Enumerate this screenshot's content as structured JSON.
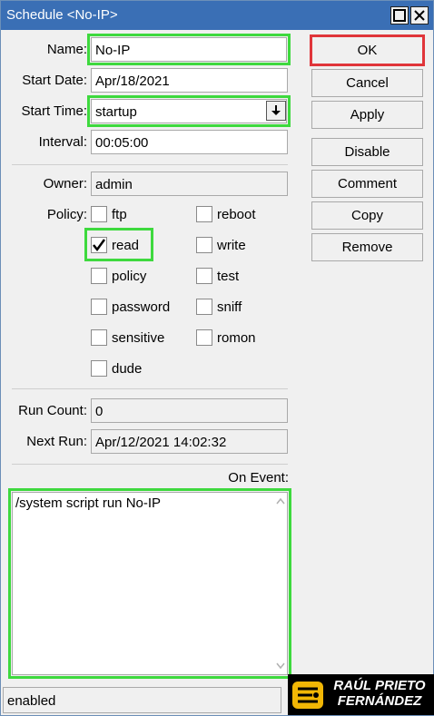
{
  "window": {
    "title": "Schedule <No-IP>"
  },
  "form": {
    "name_label": "Name:",
    "name_value": "No-IP",
    "start_date_label": "Start Date:",
    "start_date_value": "Apr/18/2021",
    "start_time_label": "Start Time:",
    "start_time_value": "startup",
    "interval_label": "Interval:",
    "interval_value": "00:05:00",
    "owner_label": "Owner:",
    "owner_value": "admin",
    "policy_label": "Policy:",
    "run_count_label": "Run Count:",
    "run_count_value": "0",
    "next_run_label": "Next Run:",
    "next_run_value": "Apr/12/2021 14:02:32",
    "on_event_label": "On Event:",
    "on_event_value": "/system script run No-IP"
  },
  "policies": [
    {
      "label": "ftp",
      "checked": false
    },
    {
      "label": "reboot",
      "checked": false
    },
    {
      "label": "read",
      "checked": true
    },
    {
      "label": "write",
      "checked": false
    },
    {
      "label": "policy",
      "checked": false
    },
    {
      "label": "test",
      "checked": false
    },
    {
      "label": "password",
      "checked": false
    },
    {
      "label": "sniff",
      "checked": false
    },
    {
      "label": "sensitive",
      "checked": false
    },
    {
      "label": "romon",
      "checked": false
    },
    {
      "label": "dude",
      "checked": false
    }
  ],
  "buttons": {
    "ok": "OK",
    "cancel": "Cancel",
    "apply": "Apply",
    "disable": "Disable",
    "comment": "Comment",
    "copy": "Copy",
    "remove": "Remove"
  },
  "status": "enabled",
  "logo": {
    "line1": "RAÚL PRIETO",
    "line2": "FERNÁNDEZ"
  },
  "colors": {
    "titlebar": "#3a6fb5",
    "highlight_green": "#3ed93e",
    "highlight_red": "#e0353a"
  }
}
